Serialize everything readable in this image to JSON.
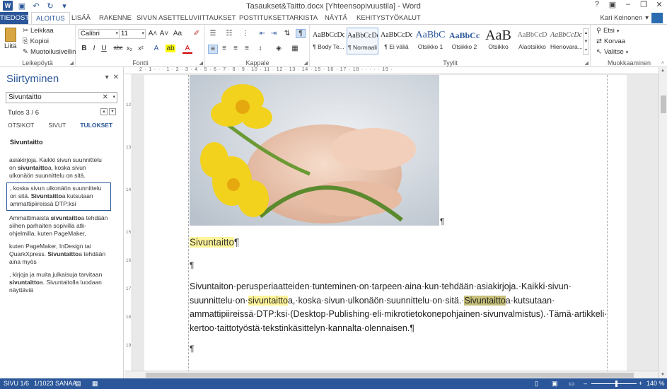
{
  "window": {
    "title": "Tasaukset&Taitto.docx [Yhteensopivuustila] - Word",
    "controls": [
      "?",
      "▣",
      "–",
      "❐",
      "✕"
    ]
  },
  "tabs": {
    "file": "TIEDOSTO",
    "items": [
      "ALOITUS",
      "LISÄÄ",
      "RAKENNE",
      "SIVUN ASETTELU",
      "VIITTAUKSET",
      "POSTITUKSET",
      "TARKISTA",
      "NÄYTÄ",
      "KEHITYSTYÖKALUT"
    ],
    "active": "ALOITUS",
    "user": "Kari Keinonen"
  },
  "ribbon": {
    "clipboard": {
      "label": "Leikepöytä",
      "paste": "Liitä",
      "cut": "Leikkaa",
      "copy": "Kopioi",
      "format_painter": "Muotoilusivellin"
    },
    "font": {
      "label": "Fontti",
      "font_name": "Calibri",
      "font_size": "11"
    },
    "paragraph": {
      "label": "Kappale"
    },
    "styles": {
      "label": "Tyylit",
      "items": [
        {
          "sample": "AaBbCcDc",
          "name": "¶ Body Te..."
        },
        {
          "sample": "AaBbCcDc",
          "name": "¶ Normaali"
        },
        {
          "sample": "AaBbCcDc",
          "name": "¶ Ei väliä"
        },
        {
          "sample": "AaBbC",
          "name": "Otsikko 1"
        },
        {
          "sample": "AaBbCc",
          "name": "Otsikko 2"
        },
        {
          "sample": "AaB",
          "name": "Otsikko"
        },
        {
          "sample": "AaBbCcD",
          "name": "Alaotsikko"
        },
        {
          "sample": "AaBbCcDc",
          "name": "Hienovara..."
        }
      ]
    },
    "editing": {
      "label": "Muokkaaminen",
      "find": "Etsi",
      "replace": "Korvaa",
      "select": "Valitse"
    }
  },
  "navpane": {
    "title": "Siirtyminen",
    "search_value": "Sivuntaitto",
    "result_count": "Tulos 3 / 6",
    "tabs": [
      "OTSIKOT",
      "SIVUT",
      "TULOKSET"
    ],
    "results_heading": "Sivuntaitto",
    "results": [
      {
        "pre": "asiakirjoja. Kaikki sivun suunnittelu on ",
        "bold": "sivuntaitto",
        "post": "a, koska sivun ulkonäön suunnittelu on sitä."
      },
      {
        "pre": ", koska sivun ulkonäön suunnittelu on sitä. ",
        "bold": "Sivuntaitto",
        "post": "a kutsutaan ammattipiireissä DTP:ksi"
      },
      {
        "pre": "Ammattimaista ",
        "bold": "sivuntaitto",
        "post": "a tehdään siihen parhaiten sopivilla atk-ohjelmilla, kuten PageMaker,"
      },
      {
        "pre": "kuten PageMaker, InDesign tai QuarkXpress. ",
        "bold": "Sivuntaitto",
        "post": "a tehdään aina myös"
      },
      {
        "pre": ", kirjoja ja muita julkaisuja tarvitaan ",
        "bold": "sivuntaitto",
        "post": "a. Sivuntaitolla luodaan näyttäviä"
      }
    ]
  },
  "document": {
    "heading": "Sivuntaitto",
    "pilcrow": "¶",
    "para_line1": "Sivuntaiton·perusperiaatteiden·tunteminen·on·tarpeen·aina·kun·tehdään·asiakirjoja.·Kaikki·sivun·",
    "para_line2_a": "suunnittelu·on·",
    "para_line2_hl": "sivuntaitto",
    "para_line2_b": "a,·koska·sivun·ulkonäön·suunnittelu·on·sitä.·",
    "para_line2_hl2": "Sivuntaitto",
    "para_line2_c": "a·kutsutaan·",
    "para_line3": "ammattipiireissä·DTP:ksi·(Desktop·Publishing·eli·mikrotietokonepohjainen·sivunvalmistus).·Tämä·artikkeli·",
    "para_line4": "kertoo·taittotyöstä·tekstinkäsittelyn·kannalta·olennaisen.¶",
    "ruler_numbers": "2 · 1 · · · 1 · 2 · 3 · 4 · 5 · 6 · 7 · 8 · 9 · 10 · 11 · 12 · 13 · 14 · 15 · 16 · 17 · 18 · · · · · 19 ·"
  },
  "statusbar": {
    "page": "SIVU 1/6",
    "words": "1/1023 SANAA",
    "zoom": "140 %"
  },
  "colors": {
    "accent": "#2b579a",
    "highlight": "#fff59a"
  }
}
